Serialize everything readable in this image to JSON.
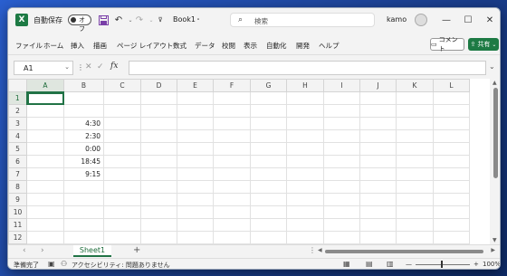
{
  "titlebar": {
    "app_icon": "X",
    "autosave_label": "自動保存",
    "autosave_state": "オフ",
    "filename": "Book1",
    "filename_suffix": "・",
    "search_placeholder": "検索",
    "username": "kamo",
    "minimize": "—",
    "maximize": "☐",
    "close": "✕"
  },
  "ribbon": {
    "tabs": [
      "ファイル",
      "ホーム",
      "挿入",
      "描画",
      "ページ レイアウト",
      "数式",
      "データ",
      "校閲",
      "表示",
      "自動化",
      "開発",
      "ヘルプ"
    ],
    "comment_label": "コメント",
    "share_label": "共有"
  },
  "formula_bar": {
    "name_box": "A1",
    "fx_label": "fx",
    "value": ""
  },
  "sheet": {
    "columns": [
      "A",
      "B",
      "C",
      "D",
      "E",
      "F",
      "G",
      "H",
      "I",
      "J",
      "K",
      "L"
    ],
    "rows": [
      {
        "n": "1",
        "B": ""
      },
      {
        "n": "2",
        "B": ""
      },
      {
        "n": "3",
        "B": "4:30"
      },
      {
        "n": "4",
        "B": "2:30"
      },
      {
        "n": "5",
        "B": "0:00"
      },
      {
        "n": "6",
        "B": "18:45"
      },
      {
        "n": "7",
        "B": "9:15"
      },
      {
        "n": "8",
        "B": ""
      },
      {
        "n": "9",
        "B": ""
      },
      {
        "n": "10",
        "B": ""
      },
      {
        "n": "11",
        "B": ""
      },
      {
        "n": "12",
        "B": ""
      }
    ],
    "active_cell": "A1"
  },
  "sheet_tabs": {
    "tabs": [
      "Sheet1"
    ],
    "add_label": "+"
  },
  "statusbar": {
    "ready": "準備完了",
    "accessibility": "アクセシビリティ: 問題ありません",
    "zoom": "100%",
    "zoom_minus": "—",
    "zoom_plus": "+"
  },
  "colors": {
    "accent": "#217346",
    "share_button": "#1d7a44"
  }
}
